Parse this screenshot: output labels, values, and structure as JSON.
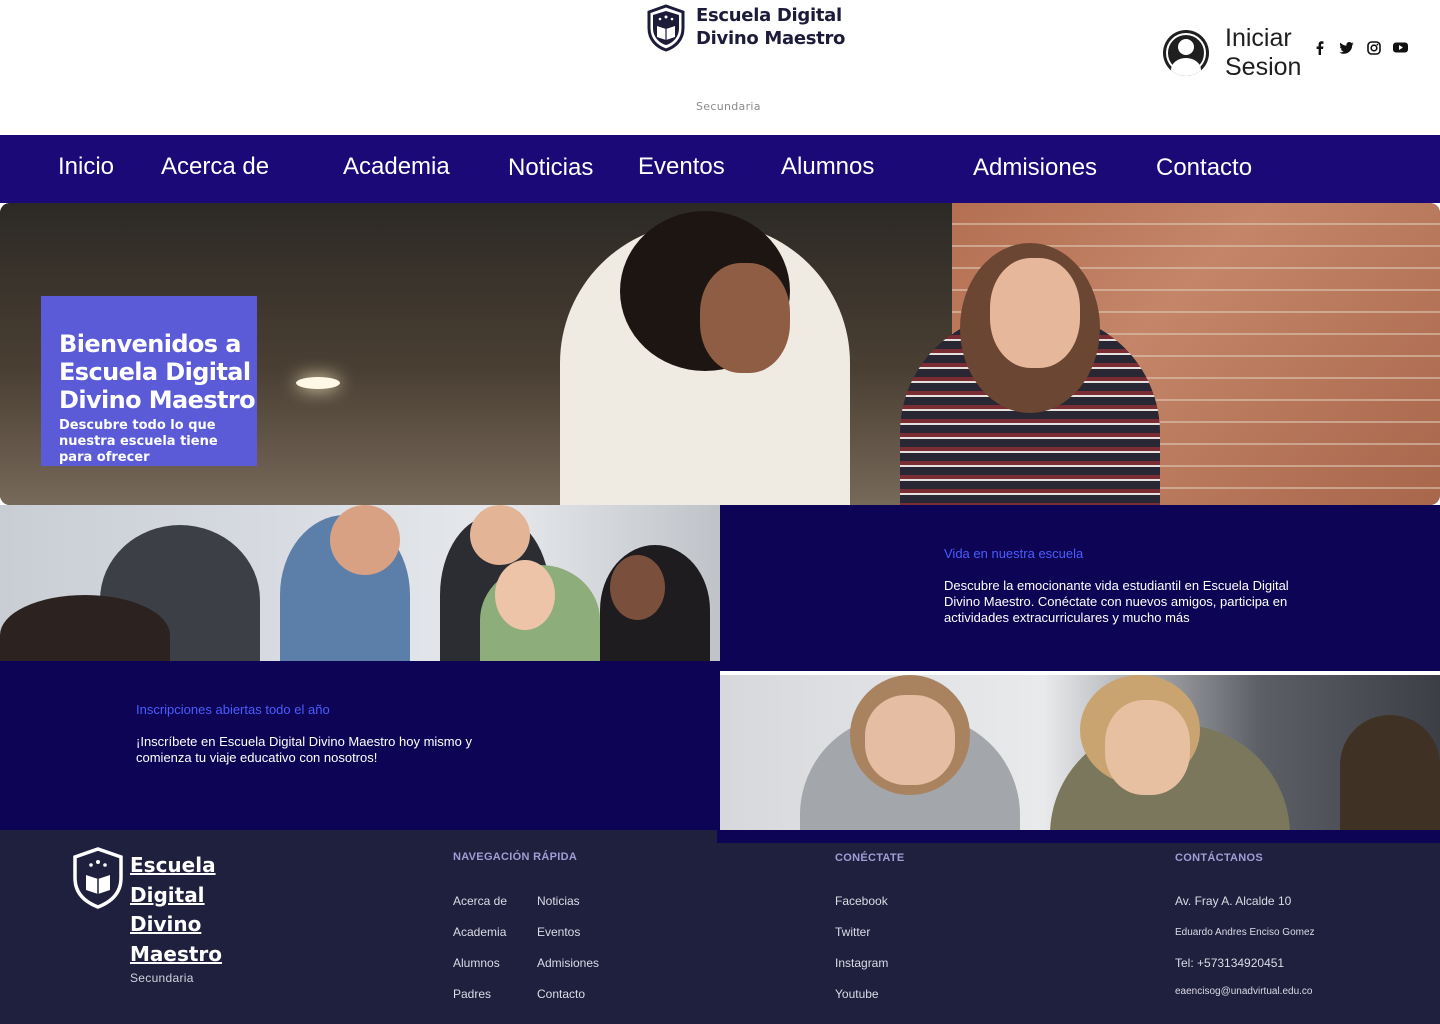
{
  "header": {
    "brand_line1": "Escuela Digital",
    "brand_line2": "Divino Maestro",
    "tagline": "Secundaria",
    "login_label": "Iniciar Sesion",
    "social_icons": [
      "facebook-icon",
      "twitter-icon",
      "instagram-icon",
      "youtube-icon"
    ]
  },
  "nav": {
    "items": [
      "Inicio",
      "Acerca de",
      "Academia",
      "Noticias",
      "Eventos",
      "Alumnos",
      "Admisiones",
      "Contacto"
    ]
  },
  "hero": {
    "title": "Bienvenidos a Escuela Digital Divino Maestro",
    "subtitle": "Descubre todo lo que nuestra escuela tiene para ofrecer"
  },
  "life": {
    "title": "Vida en nuestra escuela",
    "text": "Descubre la emocionante vida estudiantil en Escuela Digital Divino Maestro. Conéctate con nuevos amigos, participa en actividades extracurriculares y mucho más"
  },
  "enroll": {
    "title": "Inscripciones abiertas todo el año",
    "text": "¡Inscríbete en Escuela Digital Divino Maestro hoy mismo y comienza tu viaje educativo con nosotros!"
  },
  "footer": {
    "brand": "Escuela Digital Divino Maestro",
    "sub": "Secundaria",
    "quick_nav_title": "NAVEGACIÓN RÁPIDA",
    "quick_nav_col1": [
      "Acerca de",
      "Academia",
      "Alumnos",
      "Padres"
    ],
    "quick_nav_col2": [
      "Noticias",
      "Eventos",
      "Admisiones",
      "Contacto"
    ],
    "connect_title": "CONÉCTATE",
    "connect_links": [
      "Facebook",
      "Twitter",
      "Instagram",
      "Youtube"
    ],
    "contact_title": "CONTÁCTANOS",
    "address": "Av. Fray A. Alcalde 10",
    "name": "Eduardo Andres Enciso Gomez",
    "phone": "Tel: +573134920451",
    "email": "eaencisog@unadvirtual.edu.co"
  },
  "colors": {
    "nav_bg": "#1b0978",
    "panel_bg": "#0e0455",
    "footer_bg": "#1f1f3e",
    "hero_card": "#5b5bd8",
    "accent_text": "#4a5cff"
  }
}
